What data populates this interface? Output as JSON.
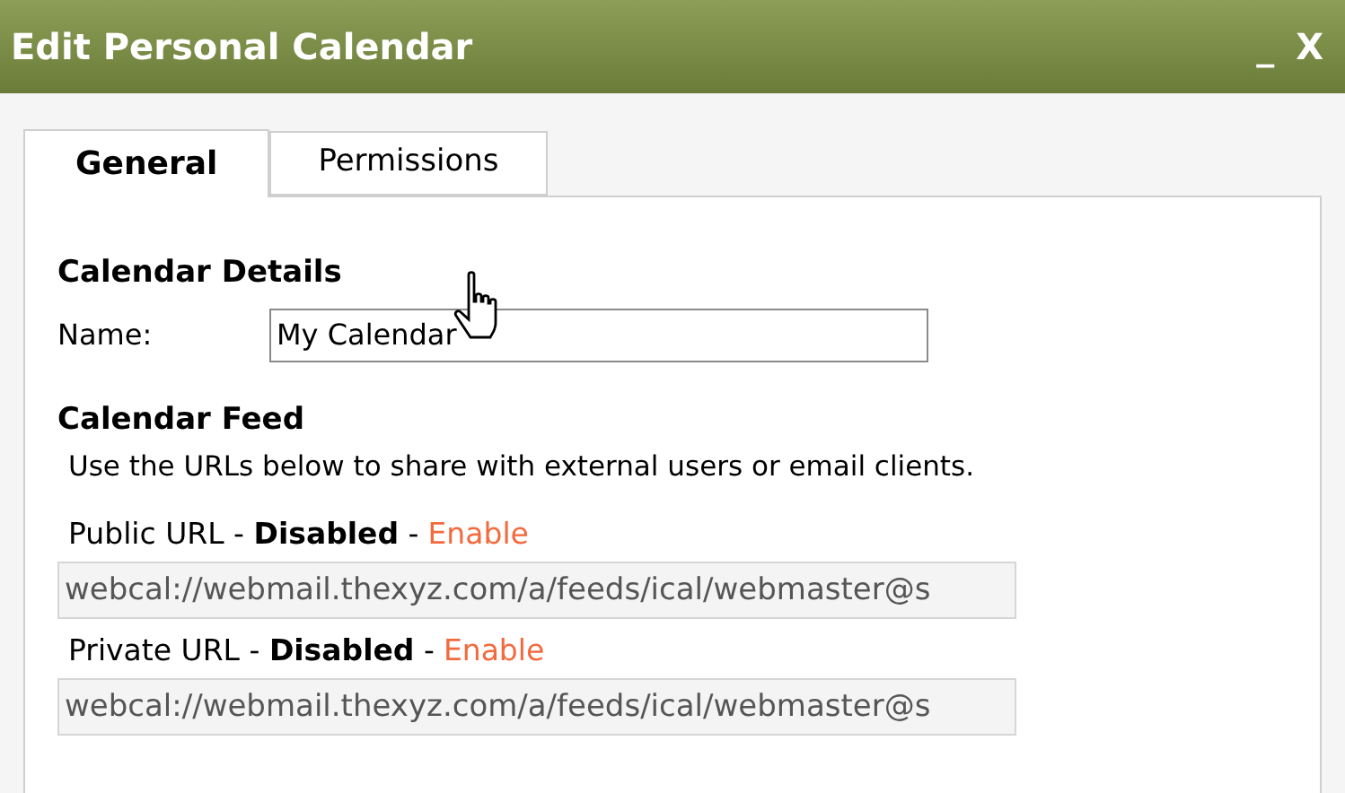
{
  "window": {
    "title": "Edit Personal Calendar",
    "controls": [
      "_",
      "X"
    ]
  },
  "tabs": [
    {
      "label": "General",
      "selected": true
    },
    {
      "label": "Permissions",
      "selected": false
    }
  ],
  "details": {
    "heading": "Calendar Details",
    "name_label": "Name:",
    "name_value": "My Calendar"
  },
  "feed": {
    "heading": "Calendar Feed",
    "description": "Use the URLs below to share with external users or email clients.",
    "urls": [
      {
        "label": "Public URL - **Disabled** -",
        "link": "Enable",
        "value": "webcal://webmail.thexyz.com/a/feeds/ical/webmaster@s"
      },
      {
        "label": "Private URL - **Disabled** -",
        "link": "Enable",
        "value": "webcal://webmail.thexyz.com/a/feeds/ical/webmaster@s"
      }
    ]
  }
}
